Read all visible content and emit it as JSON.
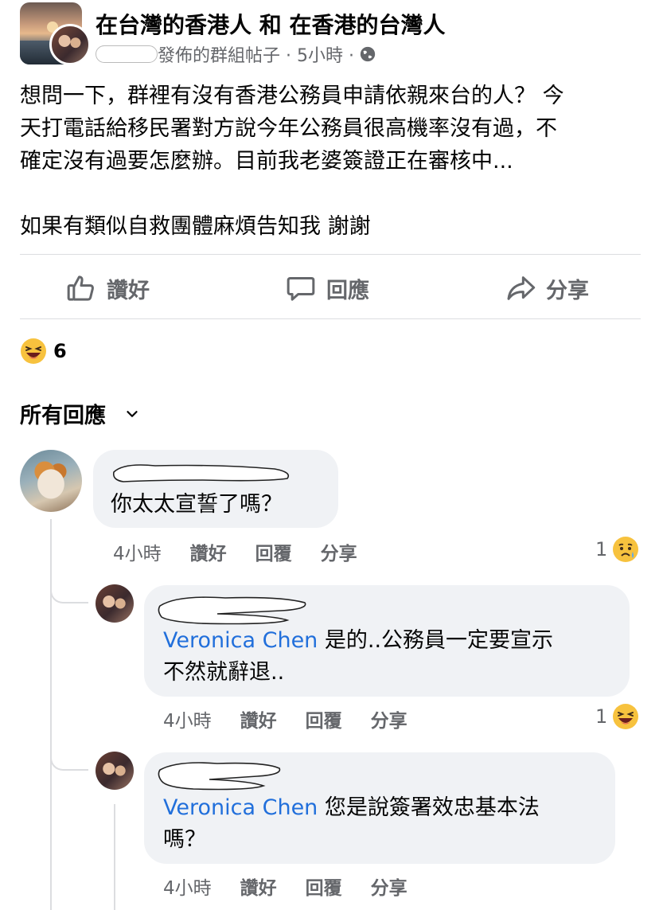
{
  "group": {
    "title": "在台灣的香港人 和 在香港的台灣人",
    "meta_suffix": "發佈的群組帖子 · 5小時 ·"
  },
  "post": {
    "lines": [
      "想問一下，群裡有沒有香港公務員申請依親來台的人？ 今",
      "天打電話給移民署對方說今年公務員很高機率沒有過，不",
      "確定沒有過要怎麼辦。目前我老婆簽證正在審核中..."
    ],
    "line2": "如果有類似自救團體麻煩告知我 謝謝"
  },
  "actions": {
    "like": "讚好",
    "comment": "回應",
    "share": "分享"
  },
  "reactions": {
    "count": "6",
    "emoji": "laughing-emoji"
  },
  "replies_header": "所有回應",
  "comments": [
    {
      "text": "你太太宣誓了嗎？",
      "time": "4小時",
      "like": "讚好",
      "reply": "回覆",
      "share": "分享",
      "react_count": "1",
      "react_emoji": "sad-emoji"
    },
    {
      "mention": "Veronica Chen",
      "text_1": " 是的..公務員一定要宣示",
      "text_2": "不然就辭退..",
      "time": "4小時",
      "like": "讚好",
      "reply": "回覆",
      "share": "分享",
      "react_count": "1",
      "react_emoji": "laughing-emoji"
    },
    {
      "mention": "Veronica Chen",
      "text_1": " 您是說簽署效忠基本法",
      "text_2": "嗎？",
      "time": "4小時",
      "like": "讚好",
      "reply": "回覆",
      "share": "分享"
    }
  ],
  "colors": {
    "mention": "#216fdb",
    "muted": "#65676b",
    "bubble": "#f0f2f5"
  }
}
